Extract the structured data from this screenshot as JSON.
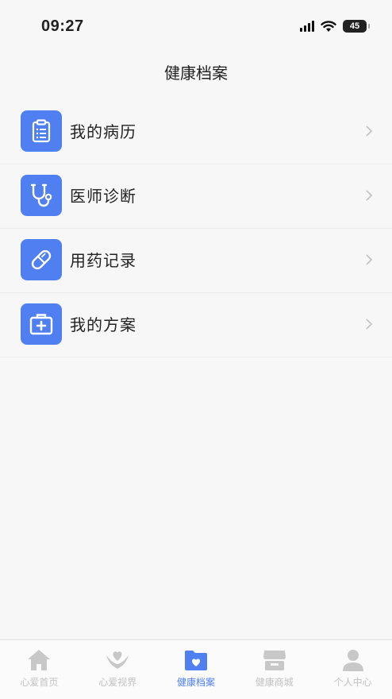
{
  "status_bar": {
    "time": "09:27",
    "battery": "45"
  },
  "header": {
    "title": "健康档案"
  },
  "menu": [
    {
      "label": "我的病历",
      "icon": "clipboard-icon"
    },
    {
      "label": "医师诊断",
      "icon": "stethoscope-icon"
    },
    {
      "label": "用药记录",
      "icon": "pill-icon"
    },
    {
      "label": "我的方案",
      "icon": "medical-kit-icon"
    }
  ],
  "tabbar": {
    "items": [
      {
        "label": "心爱首页",
        "icon": "home-icon",
        "active": false
      },
      {
        "label": "心爱视界",
        "icon": "heart-hands-icon",
        "active": false
      },
      {
        "label": "健康档案",
        "icon": "heart-folder-icon",
        "active": true
      },
      {
        "label": "健康商城",
        "icon": "store-icon",
        "active": false
      },
      {
        "label": "个人中心",
        "icon": "person-icon",
        "active": false
      }
    ]
  },
  "colors": {
    "accent": "#4f7ff0",
    "inactive": "#c8c8c8",
    "background": "#f7f7f7"
  }
}
